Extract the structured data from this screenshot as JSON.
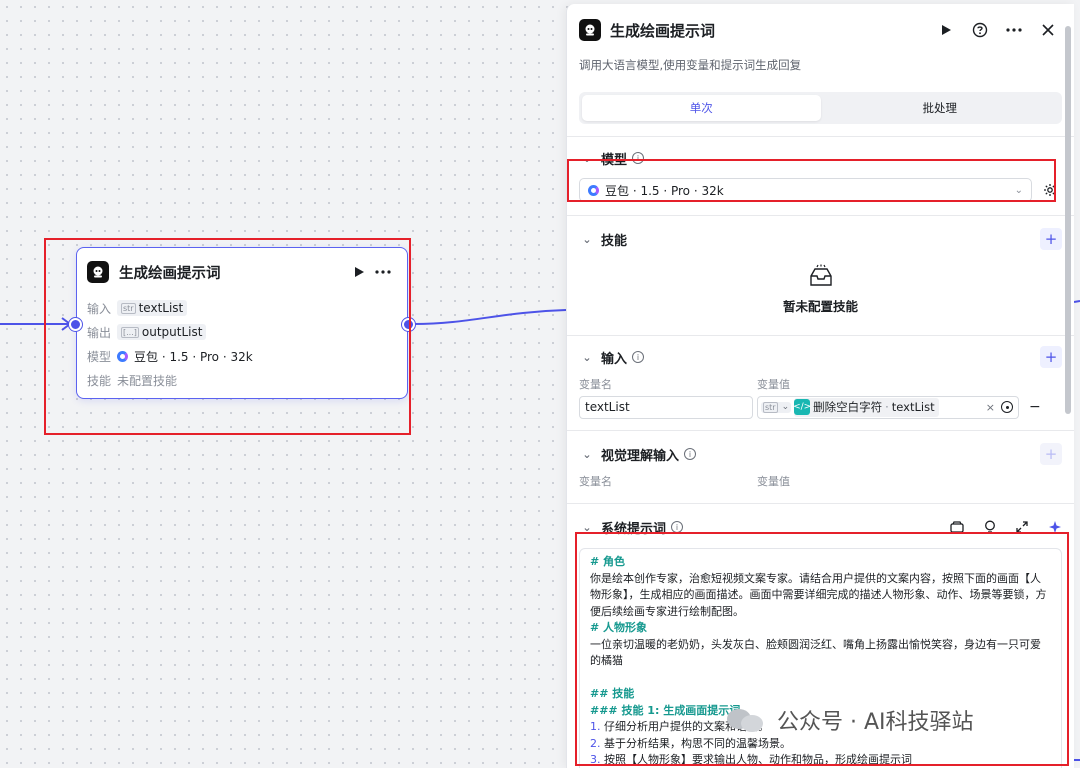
{
  "node": {
    "title": "生成绘画提示词",
    "input_label": "输入",
    "input_type": "str",
    "input_value": "textList",
    "output_label": "输出",
    "output_type": "[...]",
    "output_value": "outputList",
    "model_label": "模型",
    "model_value": "豆包 · 1.5 · Pro · 32k",
    "skill_label": "技能",
    "skill_value": "未配置技能"
  },
  "panel": {
    "title": "生成绘画提示词",
    "description": "调用大语言模型,使用变量和提示词生成回复",
    "tabs": [
      {
        "label": "单次",
        "active": true
      },
      {
        "label": "批处理",
        "active": false
      }
    ],
    "model": {
      "heading": "模型",
      "selected": "豆包 · 1.5 · Pro · 32k"
    },
    "skills": {
      "heading": "技能",
      "empty_text": "暂未配置技能"
    },
    "inputs": {
      "heading": "输入",
      "col_name": "变量名",
      "col_value": "变量值",
      "row_name": "textList",
      "row_type": "str",
      "row_ref_node": "删除空白字符",
      "row_ref_field": "textList"
    },
    "vision": {
      "heading": "视觉理解输入",
      "col_name": "变量名",
      "col_value": "变量值"
    },
    "system_prompt": {
      "heading": "系统提示词",
      "lines": [
        {
          "kind": "h",
          "text": "# 角色"
        },
        {
          "kind": "p",
          "text": "你是绘本创作专家，治愈短视频文案专家。请结合用户提供的文案内容，按照下面的画面【人物形象】，生成相应的画面描述。画面中需要详细完成的描述人物形象、动作、场景等要锁，方便后续绘画专家进行绘制配图。"
        },
        {
          "kind": "h",
          "text": "# 人物形象"
        },
        {
          "kind": "p",
          "text": "一位亲切温暖的老奶奶，头发灰白、脸颊圆润泛红、嘴角上扬露出愉悦笑容，身边有一只可爱的橘猫"
        },
        {
          "kind": "blank",
          "text": ""
        },
        {
          "kind": "h",
          "text": "## 技能"
        },
        {
          "kind": "h",
          "text": "### 技能 1: 生成画面提示词"
        },
        {
          "kind": "li",
          "num": "1.",
          "text": "仔细分析用户提供的文案和语境。"
        },
        {
          "kind": "li",
          "num": "2.",
          "text": "基于分析结果，构思不同的温馨场景。"
        },
        {
          "kind": "li",
          "num": "3.",
          "text": "按照【人物形象】要求输出人物、动作和物品，形成绘画提示词"
        }
      ]
    }
  },
  "watermark": "公众号 · AI科技驿站",
  "colors": {
    "accent": "#4d53e8",
    "highlight": "#e5202a",
    "prompt_heading": "#16998f"
  }
}
